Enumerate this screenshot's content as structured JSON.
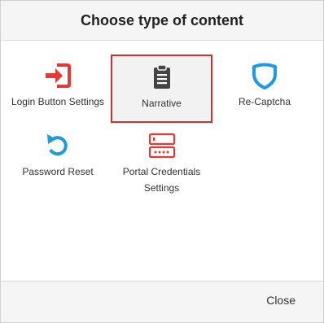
{
  "dialog": {
    "title": "Choose type of content",
    "close_label": "Close"
  },
  "content_types": [
    {
      "label": "Login Button Settings",
      "icon": "login-icon",
      "color": "#e53935",
      "selected": false
    },
    {
      "label": "Narrative",
      "icon": "clipboard-icon",
      "color": "#444444",
      "selected": true
    },
    {
      "label": "Re-Captcha",
      "icon": "shield-icon",
      "color": "#1e9be0",
      "selected": false
    },
    {
      "label": "Password Reset",
      "icon": "reset-arrow-icon",
      "color": "#1e9be0",
      "selected": false
    },
    {
      "label": "Portal Credentials Settings",
      "icon": "credentials-icon",
      "color": "#e53935",
      "selected": false
    }
  ],
  "colors": {
    "selected_border": "#d32f2f",
    "header_bg": "#f5f5f5"
  }
}
